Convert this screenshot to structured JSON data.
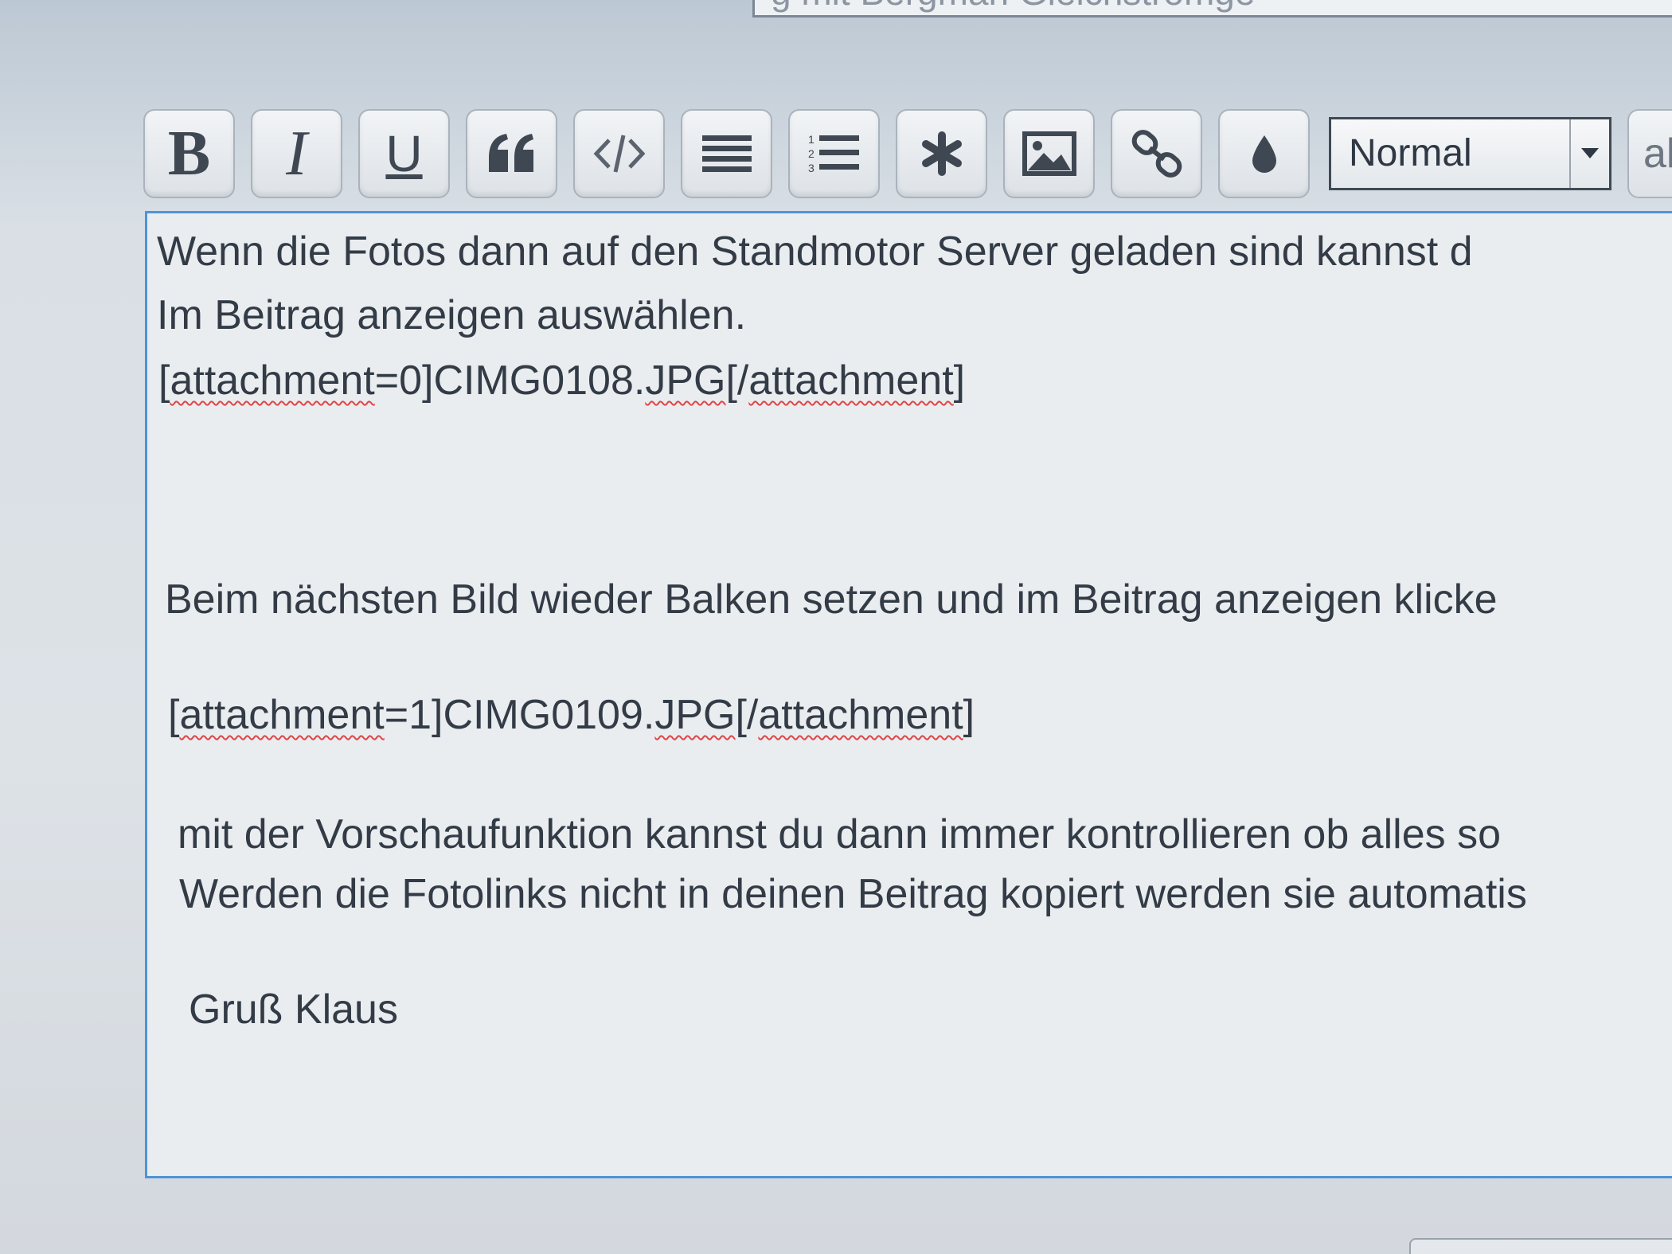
{
  "subject": {
    "value": "g                        mit Bergman Gleichstromge"
  },
  "toolbar": {
    "buttons": [
      {
        "id": "bold",
        "label": "B",
        "icon": "bold-icon"
      },
      {
        "id": "italic",
        "label": "I",
        "icon": "italic-icon"
      },
      {
        "id": "underline",
        "label": "U",
        "icon": "underline-icon"
      },
      {
        "id": "quote",
        "icon": "quote-icon"
      },
      {
        "id": "code",
        "icon": "code-icon"
      },
      {
        "id": "list",
        "icon": "list-icon"
      },
      {
        "id": "ordered-list",
        "icon": "ordered-list-icon"
      },
      {
        "id": "list-item",
        "icon": "asterisk-icon"
      },
      {
        "id": "image",
        "icon": "image-icon"
      },
      {
        "id": "link",
        "icon": "link-icon"
      },
      {
        "id": "color",
        "icon": "droplet-icon"
      }
    ],
    "font_size_select": {
      "value": "Normal"
    },
    "partial_button_label": "al"
  },
  "editor": {
    "lines": [
      "Wenn die Fotos dann auf den Standmotor Server geladen sind kannst d",
      "Im Beitrag  anzeigen auswählen.",
      "",
      "Beim nächsten Bild wieder Balken setzen und im Beitrag anzeigen klicke",
      "mit der Vorschaufunktion kannst du dann immer kontrollieren ob alles so",
      "Werden die Fotolinks nicht in deinen Beitrag kopiert werden sie automatis",
      "Gruß Klaus"
    ],
    "attachment_lines": [
      {
        "open": "[",
        "tag": "attachment",
        "mid": "=0]CIMG0108.",
        "ext": "JPG",
        "close_open": "[/",
        "close_tag": "attachment",
        "close_end": "]"
      },
      {
        "open": "[",
        "tag": "attachment",
        "mid": "=1]CIMG0109.",
        "ext": "JPG",
        "close_open": "[/",
        "close_tag": "attachment",
        "close_end": "]"
      }
    ]
  },
  "colors": {
    "editor_border": "#4f94d6",
    "spellcheck_underline": "#e04545",
    "text": "#333c46"
  }
}
